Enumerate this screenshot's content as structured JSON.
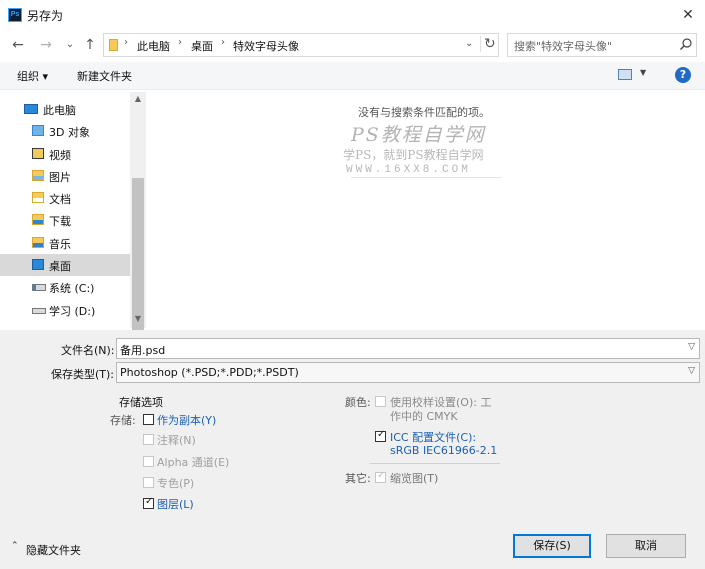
{
  "window": {
    "title": "另存为",
    "app_icon_text": "Ps",
    "close_glyph": "✕"
  },
  "nav": {
    "back": "←",
    "forward": "→",
    "recent": "⌄",
    "up": "↑",
    "refresh": "↻",
    "dropdown": "⌄"
  },
  "breadcrumb": [
    "此电脑",
    "桌面",
    "特效字母头像"
  ],
  "search": {
    "placeholder": "搜索\"特效字母头像\""
  },
  "toolbar": {
    "organize": "组织 ▾",
    "new_folder": "新建文件夹",
    "help": "?"
  },
  "tree": {
    "root": "此电脑",
    "items": [
      {
        "label": "3D 对象",
        "icon": "folder-3d-icon"
      },
      {
        "label": "视频",
        "icon": "video-folder-icon"
      },
      {
        "label": "图片",
        "icon": "pictures-folder-icon"
      },
      {
        "label": "文档",
        "icon": "documents-folder-icon"
      },
      {
        "label": "下载",
        "icon": "downloads-folder-icon"
      },
      {
        "label": "音乐",
        "icon": "music-folder-icon"
      },
      {
        "label": "桌面",
        "icon": "desktop-folder-icon",
        "selected": true
      },
      {
        "label": "系统 (C:)",
        "icon": "system-drive-icon"
      },
      {
        "label": "学习 (D:)",
        "icon": "drive-icon"
      }
    ]
  },
  "content": {
    "empty_message": "没有与搜索条件匹配的项。",
    "watermark_title": "PS教程自学网",
    "watermark_sub": "学PS，就到PS教程自学网",
    "watermark_url": "WWW.16XX8.COM"
  },
  "form": {
    "filename_label": "文件名(N):",
    "filename_value": "备用.psd",
    "filetype_label": "保存类型(T):",
    "filetype_value": "Photoshop (*.PSD;*.PDD;*.PSDT)",
    "save_options_title": "存储选项",
    "storage_label": "存储:",
    "as_copy": "作为副本(Y)",
    "notes": "注释(N)",
    "alpha": "Alpha 通道(E)",
    "spot": "专色(P)",
    "layers": "图层(L)",
    "color_label": "颜色:",
    "proof_line1": "使用校样设置(O): 工",
    "proof_line2": "作中的 CMYK",
    "icc_line1": "ICC 配置文件(C):",
    "icc_line2": "sRGB IEC61966-2.1",
    "other_label": "其它:",
    "thumbnail": "缩览图(T)",
    "check_glyph": "✓"
  },
  "footer": {
    "hide_folders": "隐藏文件夹",
    "save": "保存(S)",
    "cancel": "取消"
  }
}
